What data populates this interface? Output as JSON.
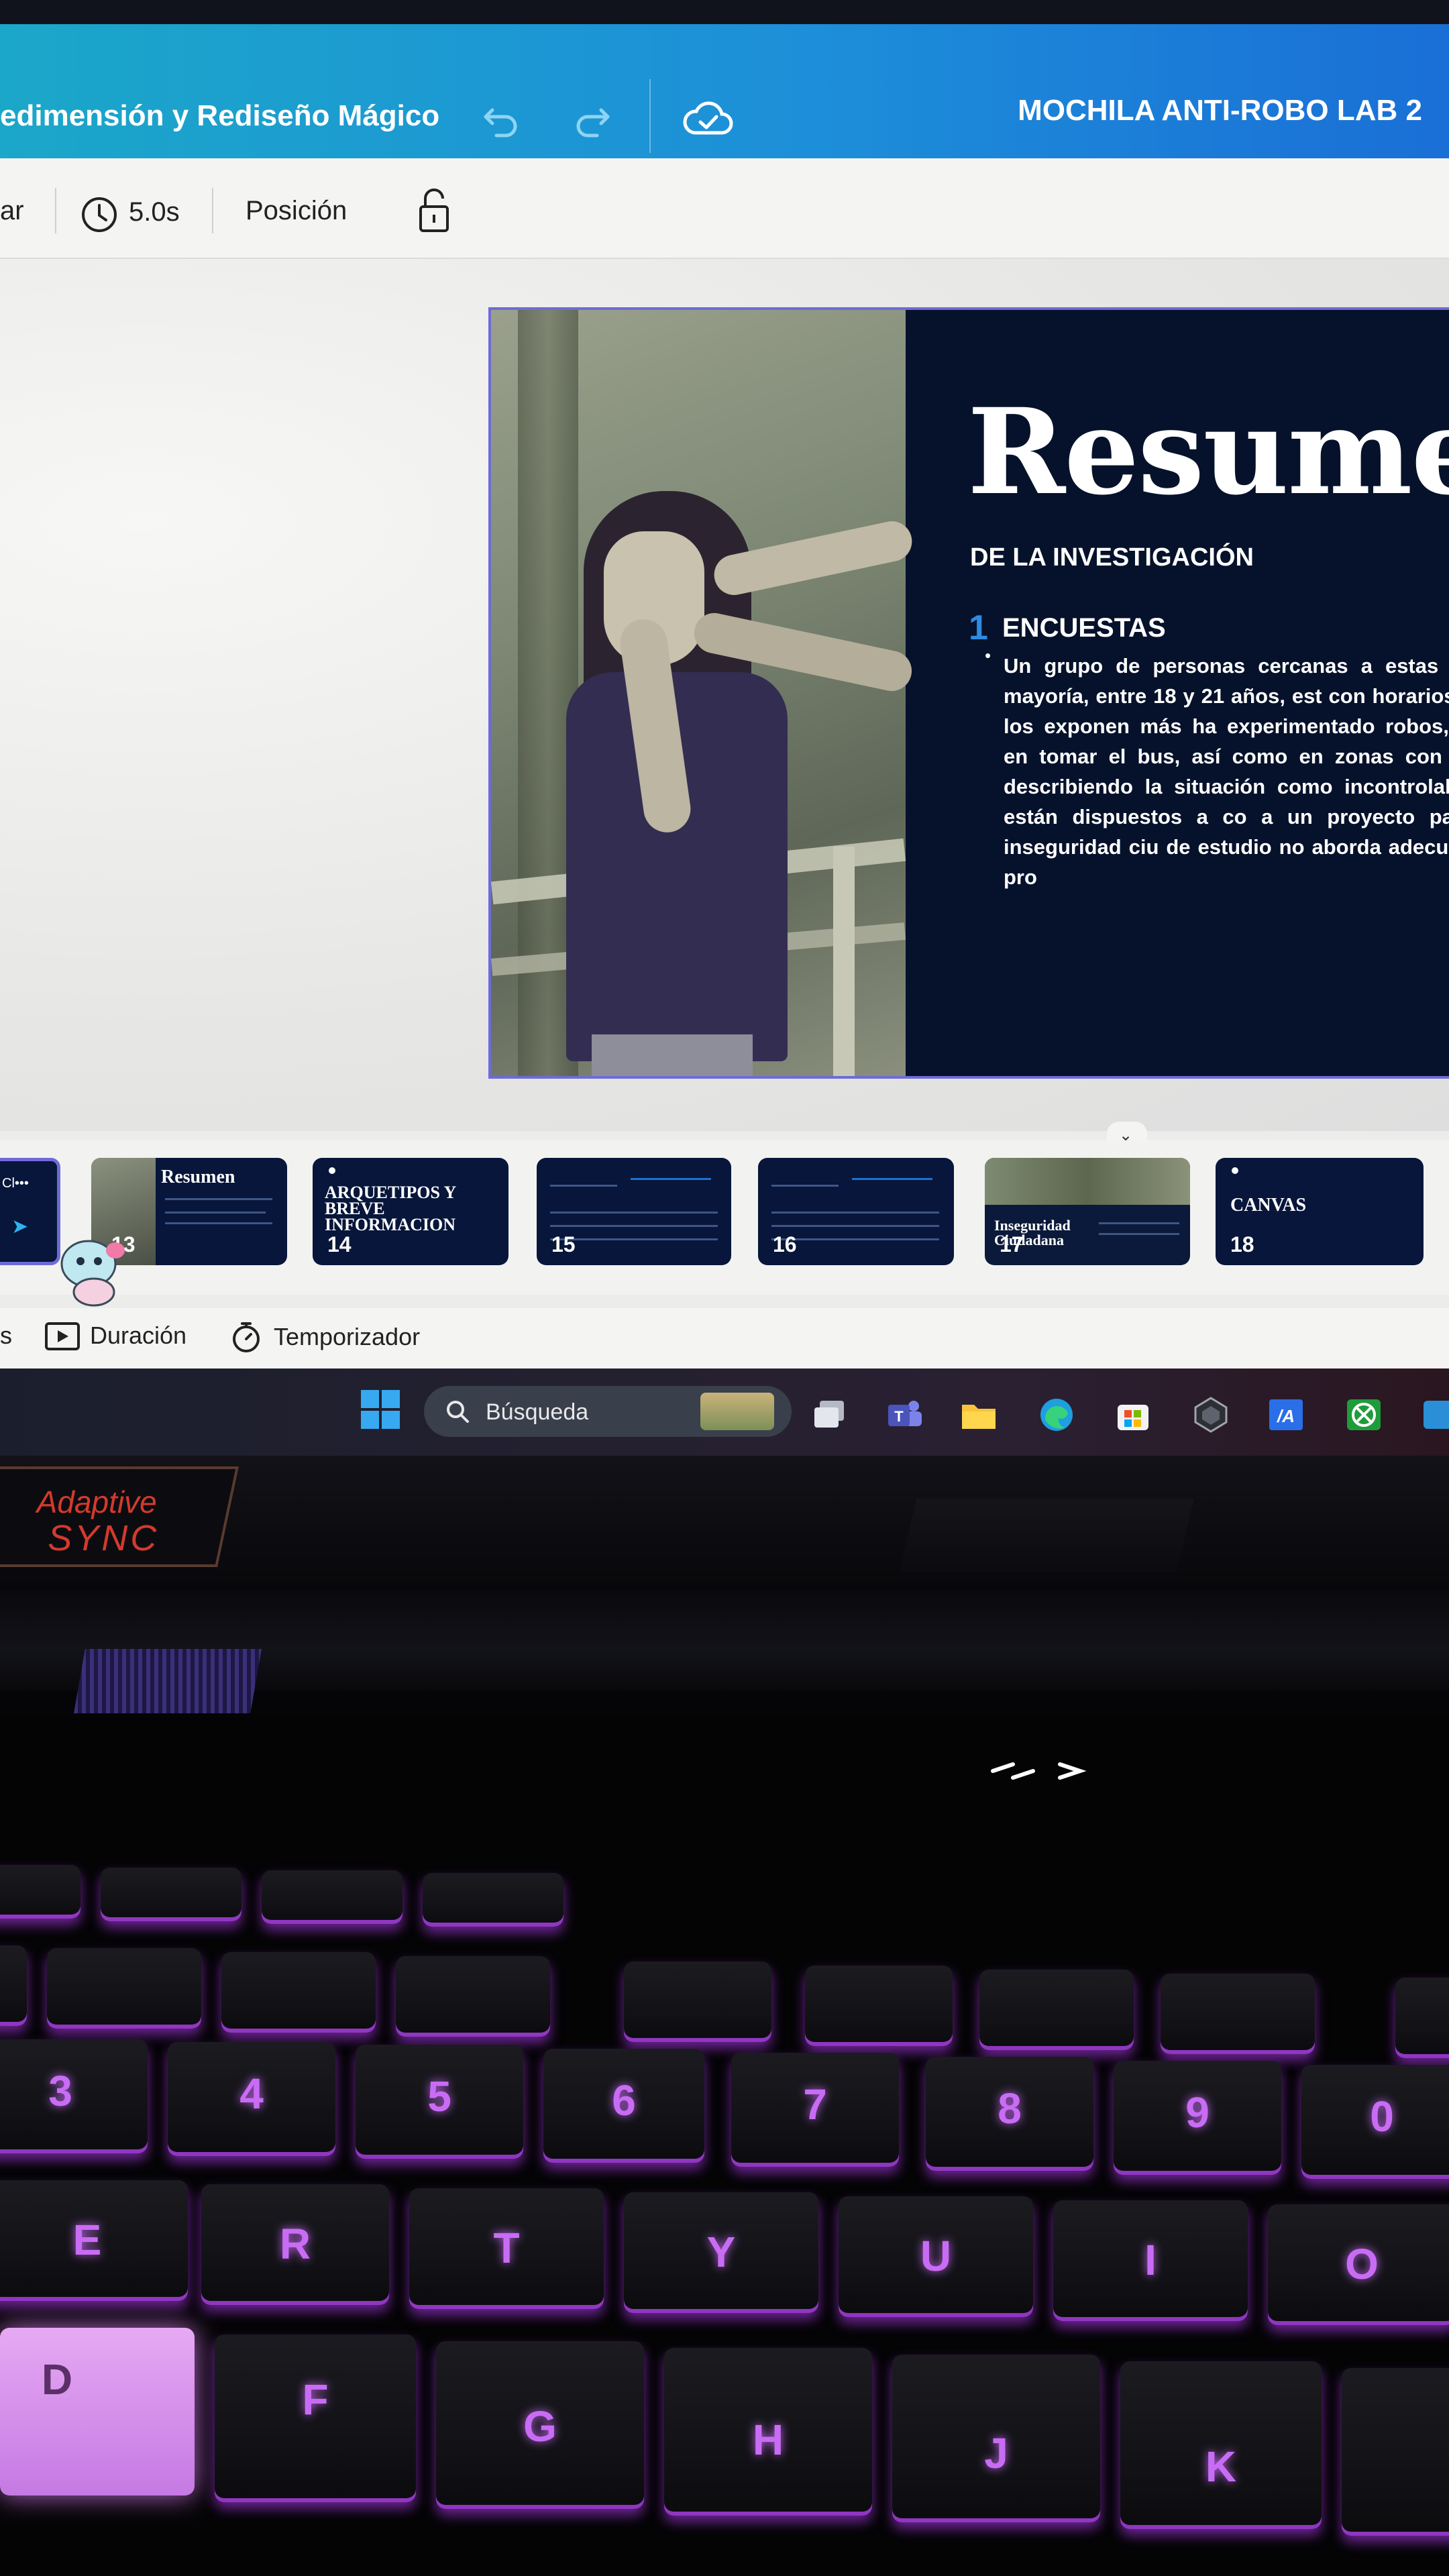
{
  "header": {
    "title": "edimensión y Rediseño Mágico",
    "project_name": "MOCHILA ANTI-ROBO LAB 2"
  },
  "toolbar": {
    "cut_label": "ar",
    "duration": "5.0s",
    "position_label": "Posición"
  },
  "slide": {
    "heading": "Resume",
    "subtitle": "DE LA INVESTIGACIÓN",
    "section_number": "1",
    "section_title": "ENCUESTAS",
    "bullet": "•",
    "body": "Un grupo de personas cercanas a estas z encuesta. La mayoría, entre 18 y 21 años, est con horarios nocturnos que los exponen más ha experimentado robos, principalmente en tomar el bus, así como en zonas con poc seguridad, describiendo la situación como incontrolable. Por último, están dispuestos a co a un proyecto para combatir la inseguridad ciu de estudio no aborda adecuadamente estos pro"
  },
  "filmstrip": {
    "thumbs": [
      {
        "label": "Cl•••",
        "number": ""
      },
      {
        "label": "Resumen",
        "number": "13"
      },
      {
        "label": "ARQUETIPOS Y BREVE INFORMACION",
        "number": "14"
      },
      {
        "label": "",
        "number": "15"
      },
      {
        "label": "",
        "number": "16"
      },
      {
        "label": "Inseguridad Ciudadana",
        "number": "17"
      },
      {
        "label": "CANVAS",
        "number": "18"
      }
    ]
  },
  "bottombar": {
    "left_cut": "s",
    "duration_label": "Duración",
    "timer_label": "Temporizador"
  },
  "taskbar": {
    "search_placeholder": "Búsqueda"
  },
  "laptop": {
    "sync_line1": "Adaptive",
    "sync_line2": "SYNC"
  },
  "keyboard": {
    "keys": [
      "3",
      "4",
      "5",
      "6",
      "7",
      "8",
      "9",
      "0",
      "E",
      "R",
      "T",
      "Y",
      "U",
      "I",
      "O",
      "D",
      "F",
      "G",
      "H",
      "J",
      "K"
    ]
  },
  "colors": {
    "header_gradient_start": "#1ba7c9",
    "header_gradient_end": "#1a6fd6",
    "slide_background": "#06122b",
    "slide_accent": "#2e8be3",
    "selection_border": "#6e6bd8",
    "key_backlight": "#c96cf5",
    "sync_red": "#d33a2c"
  }
}
